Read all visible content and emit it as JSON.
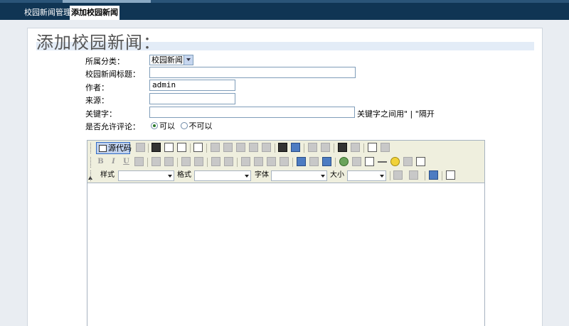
{
  "tabs": [
    {
      "label": "校园新闻管理"
    },
    {
      "label": "添加校园新闻"
    }
  ],
  "page": {
    "heading": "添加校园新闻："
  },
  "form": {
    "category": {
      "label": "所属分类：",
      "selected": "校园新闻"
    },
    "title": {
      "label": "校园新闻标题：",
      "value": ""
    },
    "author": {
      "label": "作者：",
      "value": "admin"
    },
    "source": {
      "label": "来源：",
      "value": ""
    },
    "keywords": {
      "label": "关键字：",
      "value": "",
      "hint": "关键字之间用\" | \"隔开"
    },
    "comments": {
      "label": "是否允许评论：",
      "options": [
        {
          "label": "可以",
          "checked": true
        },
        {
          "label": "不可以",
          "checked": false
        }
      ]
    }
  },
  "editor": {
    "source_button": "源代码",
    "style_label": "样式",
    "format_label": "格式",
    "font_label": "字体",
    "size_label": "大小",
    "content": ""
  }
}
